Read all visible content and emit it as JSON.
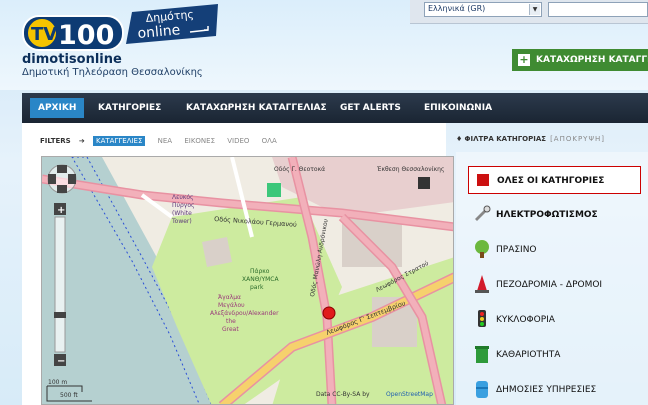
{
  "header": {
    "logo_text": "TV100",
    "logo_badge_line1": "Δημότης",
    "logo_badge_line2": "online",
    "site_name": "dimotisonline",
    "site_subtitle": "Δημοτική Τηλεόραση Θεσσαλονίκης",
    "language": "Ελληνικά (GR)",
    "report_button": "ΚΑΤΑΧΩΡΗΣΗ ΚΑΤΑΓΓΕΛΙ"
  },
  "nav": {
    "items": [
      {
        "label": "ΑΡΧΙΚΗ",
        "active": true
      },
      {
        "label": "ΚΑΤΗΓΟΡΙΕΣ"
      },
      {
        "label": "ΚΑΤΑΧΩΡΗΣΗ ΚΑΤΑΓΓΕΛΙΑΣ"
      },
      {
        "label": "GET ALERTS"
      },
      {
        "label": "ΕΠΙΚΟΙΝΩΝΙΑ"
      }
    ]
  },
  "filters": {
    "label": "FILTERS",
    "chips": [
      "ΚΑΤΑΓΓΕΛΙΕΣ",
      "ΝΕΑ",
      "ΕΙΚΟΝΕΣ",
      "VIDEO",
      "ΟΛΑ"
    ]
  },
  "map": {
    "labels": {
      "street1": "Οδός Γ. Θεοτοκά",
      "street2": "Οδός Νικολάου Γερμανού",
      "street3": "Οδός Μανώλη Ανδρόνικου",
      "street4": "Λεωφόρος Γ' Σεπτεμβρίου",
      "street5": "Λεωφόρος Στρατού",
      "lbl_expo": "Έκθεση Θεσσαλονίκης",
      "lbl_tower1": "Λευκός",
      "lbl_tower2": "Πύργος",
      "lbl_tower3": "(White",
      "lbl_tower4": "Tower)",
      "lbl_park1": "Πάρκο",
      "lbl_park2": "ΧΑΝΘ/YMCA",
      "lbl_park3": "park",
      "lbl_statue1": "Άγαλμα",
      "lbl_statue2": "Μεγάλου",
      "lbl_statue3": "Αλεξάνδρου/Alexander",
      "lbl_statue4": "the",
      "lbl_statue5": "Great",
      "attribution_prefix": "Data CC-By-SA by",
      "attribution_link": "OpenStreetMap",
      "scale_m": "100 m",
      "scale_ft": "500 ft"
    }
  },
  "sidebar": {
    "filter_title": "ΦΙΛΤΡΑ ΚΑΤΗΓΟΡΙΑΣ",
    "filter_hide": "[ΑΠΟΚΡΥΨΗ]",
    "categories": [
      {
        "label": "ΟΛΕΣ ΟΙ ΚΑΤΗΓΟΡΙΕΣ",
        "icon": "red-square-icon"
      },
      {
        "label": "ΗΛΕΚΤΡΟΦΩΤΙΣΜΟΣ",
        "icon": "light-bulb-icon"
      },
      {
        "label": "ΠΡΑΣΙΝΟ",
        "icon": "tree-icon"
      },
      {
        "label": "ΠΕΖΟΔΡΟΜΙΑ - ΔΡΟΜΟΙ",
        "icon": "traffic-cone-icon"
      },
      {
        "label": "ΚΥΚΛΟΦΟΡΙΑ",
        "icon": "traffic-light-icon"
      },
      {
        "label": "ΚΑΘΑΡΙΟΤΗΤΑ",
        "icon": "recycle-bin-icon"
      },
      {
        "label": "ΔΗΜΟΣΙΕΣ ΥΠΗΡΕΣΙΕΣ",
        "icon": "water-barrel-icon"
      }
    ]
  },
  "colors": {
    "nav_bg": "#1f2b3a",
    "accent": "#2a86c7",
    "report_green": "#3f8b32",
    "marker_red": "#e01b1b"
  }
}
